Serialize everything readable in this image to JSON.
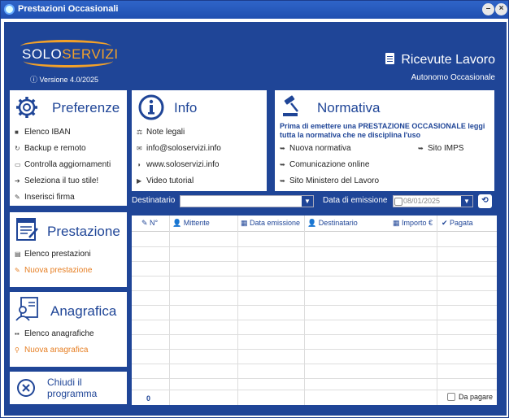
{
  "window": {
    "title": "Prestazioni Occasionali"
  },
  "header": {
    "logo_text_a": "SOLO",
    "logo_text_b": "SERVIZI",
    "version": "ⓘ Versione 4.0/2025",
    "title": "Ricevute Lavoro",
    "subtitle": "Autonomo Occasionale"
  },
  "preferenze": {
    "title": "Preferenze",
    "items": [
      "Elenco IBAN",
      "Backup e remoto",
      "Controlla aggiornamenti",
      "Seleziona il tuo stile!",
      "Inserisci firma"
    ]
  },
  "info": {
    "title": "Info",
    "items": [
      "Note legali",
      "info@soloservizi.info",
      "www.soloservizi.info",
      "Video tutorial"
    ]
  },
  "normativa": {
    "title": "Normativa",
    "notice": "Prima di emettere una PRESTAZIONE OCCASIONALE leggi tutta la normativa che ne disciplina l'uso",
    "left_links": [
      "Nuova normativa",
      "Comunicazione online",
      "Sito Ministero del Lavoro"
    ],
    "right_links": [
      "Sito IMPS"
    ]
  },
  "prestazione": {
    "title": "Prestazione",
    "items": [
      "Elenco prestazioni",
      "Nuova prestazione"
    ]
  },
  "anagrafica": {
    "title": "Anagrafica",
    "items": [
      "Elenco anagrafiche",
      "Nuova anagrafica"
    ]
  },
  "chiudi": {
    "label": "Chiudi il programma"
  },
  "filters": {
    "destinatario_label": "Destinatario",
    "destinatario_value": "",
    "data_label": "Data di emissione",
    "data_value": "08/01/2025"
  },
  "grid": {
    "columns": [
      "N°",
      "Mittente",
      "Data emissione",
      "Destinatario",
      "Importo €",
      "Pagata"
    ],
    "count": "0",
    "da_pagare": "Da pagare"
  },
  "colors": {
    "accent": "#1f4597",
    "orange": "#e67e22",
    "brand_orange": "#f2a12a"
  }
}
